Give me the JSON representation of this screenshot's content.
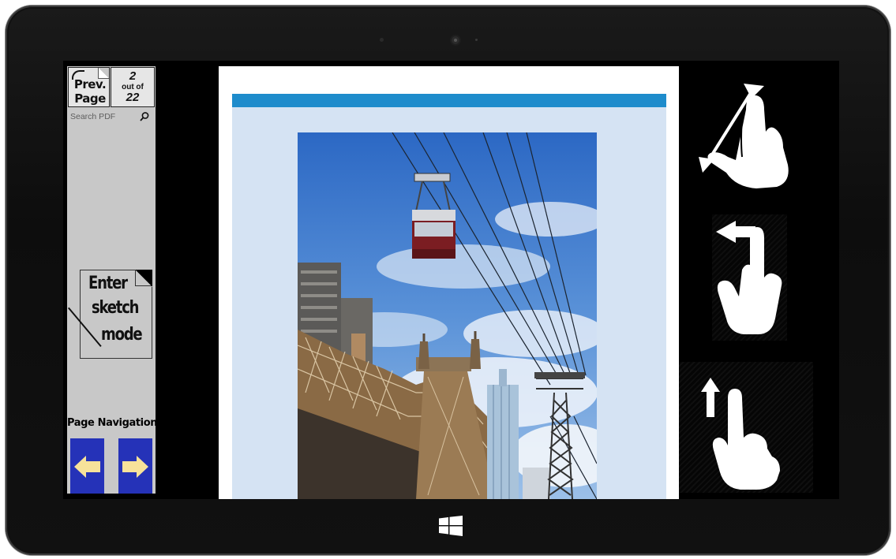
{
  "sidebar": {
    "prev_page_label_1": "Prev.",
    "prev_page_label_2": "Page",
    "page_current": "2",
    "page_out_of": "out of",
    "page_total": "22",
    "search_placeholder": "Search PDF",
    "sketch_label_1": "Enter",
    "sketch_label_2": "sketch",
    "sketch_label_3": "mode",
    "page_navigation_label": "Page Navigation"
  },
  "colors": {
    "sidebar_bg": "#c8c8c8",
    "nav_button": "#2532b8",
    "nav_arrow": "#f7e29a",
    "doc_header_bar": "#1e8ccc",
    "doc_panel": "#d5e3f3"
  },
  "icons": {
    "search": "search-icon",
    "prev_nav": "arrow-left-icon",
    "next_nav": "arrow-right-icon",
    "pinch": "pinch-zoom-gesture-icon",
    "swipe_horizontal": "swipe-horizontal-gesture-icon",
    "swipe_up": "swipe-up-gesture-icon",
    "windows": "windows-logo-icon"
  }
}
